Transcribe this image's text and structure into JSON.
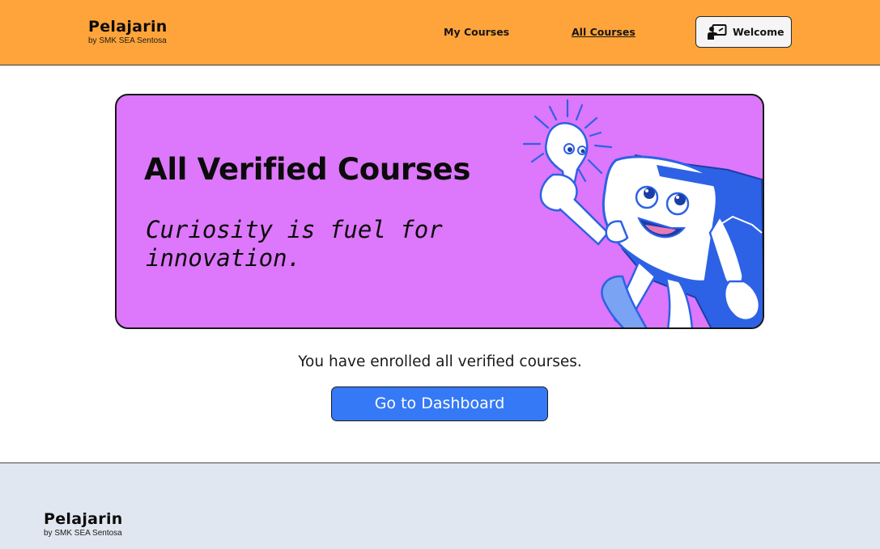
{
  "header": {
    "brand_name": "Pelajarin",
    "brand_sub": "by SMK SEA Sentosa",
    "nav": {
      "my_courses": "My Courses",
      "all_courses": "All Courses"
    },
    "welcome_label": "Welcome",
    "welcome_icon": "teacher-board-icon"
  },
  "hero": {
    "title": "All Verified Courses",
    "quote": "Curiosity is fuel for innovation.",
    "illustration": "lightbulb-and-book-characters-illustration"
  },
  "main": {
    "enrolled_message": "You have enrolled all verified courses.",
    "dashboard_button": "Go to Dashboard"
  },
  "footer": {
    "brand_name": "Pelajarin",
    "brand_sub": "by SMK SEA Sentosa"
  },
  "colors": {
    "header_bg": "#ffa43a",
    "hero_bg": "#dd77fb",
    "button_bg": "#3579f6",
    "footer_bg": "#e0e7f0",
    "illustration_blue": "#2d62e6"
  }
}
